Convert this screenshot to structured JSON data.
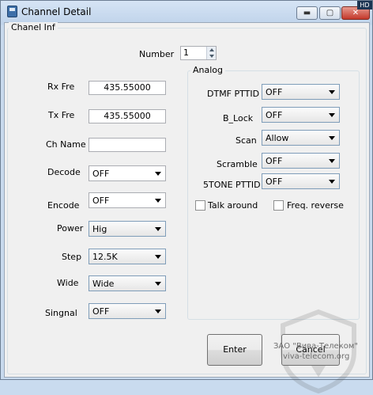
{
  "window": {
    "title": "Channel Detail",
    "icon": "radio-icon",
    "hd_badge": "HD",
    "controls": {
      "minimize": "▬",
      "maximize": "▢",
      "close": "✕"
    }
  },
  "group": {
    "title": "Chanel Inf"
  },
  "number": {
    "label": "Number",
    "value": "1"
  },
  "left_fields": {
    "rx_label": "Rx Fre",
    "rx_value": "435.55000",
    "tx_label": "Tx Fre",
    "tx_value": "435.55000",
    "chname_label": "Ch Name",
    "chname_value": "",
    "decode_label": "Decode",
    "decode_value": "OFF",
    "encode_label": "Encode",
    "encode_value": "OFF",
    "power_label": "Power",
    "power_value": "Hig",
    "step_label": "Step",
    "step_value": "12.5K",
    "wide_label": "Wide",
    "wide_value": "Wide",
    "signal_label": "Singnal",
    "signal_value": "OFF"
  },
  "analog": {
    "title": "Analog",
    "dtmf_label": "DTMF PTTID",
    "dtmf_value": "OFF",
    "block_label": "B_Lock",
    "block_value": "OFF",
    "scan_label": "Scan",
    "scan_value": "Allow",
    "scramble_label": "Scramble",
    "scramble_value": "OFF",
    "stone_label": "5TONE PTTID",
    "stone_value": "OFF",
    "talk_around_label": "Talk around",
    "talk_around_checked": false,
    "freq_reverse_label": "Freq. reverse",
    "freq_reverse_checked": false
  },
  "buttons": {
    "enter": "Enter",
    "cancel": "Cancel"
  },
  "watermark": {
    "line1": "ЗАО \"Вива-Телеком\"",
    "line2": "viva-telecom.org"
  }
}
